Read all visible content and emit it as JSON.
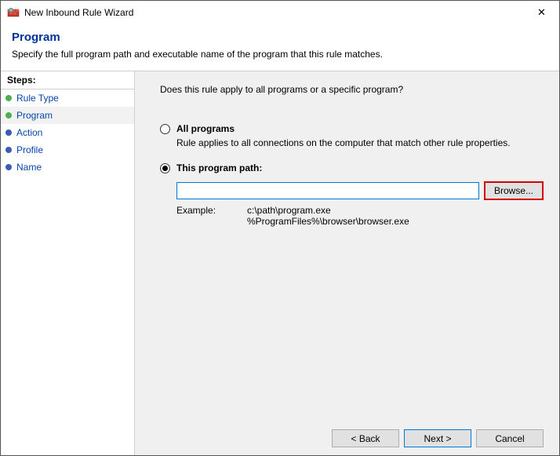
{
  "window": {
    "title": "New Inbound Rule Wizard",
    "close_glyph": "✕"
  },
  "header": {
    "title": "Program",
    "subtitle": "Specify the full program path and executable name of the program that this rule matches."
  },
  "sidebar": {
    "header": "Steps:",
    "items": [
      {
        "label": "Rule Type",
        "bullet_color": "#4caf50",
        "selected": false
      },
      {
        "label": "Program",
        "bullet_color": "#4caf50",
        "selected": true
      },
      {
        "label": "Action",
        "bullet_color": "#3b5bb5",
        "selected": false
      },
      {
        "label": "Profile",
        "bullet_color": "#3b5bb5",
        "selected": false
      },
      {
        "label": "Name",
        "bullet_color": "#3b5bb5",
        "selected": false
      }
    ]
  },
  "content": {
    "question": "Does this rule apply to all programs or a specific program?",
    "options": {
      "all": {
        "title": "All programs",
        "desc": "Rule applies to all connections on the computer that match other rule properties."
      },
      "path": {
        "title": "This program path:",
        "input_value": "",
        "browse_label": "Browse...",
        "example_label": "Example:",
        "example_text": "c:\\path\\program.exe\n%ProgramFiles%\\browser\\browser.exe"
      }
    }
  },
  "footer": {
    "back": "< Back",
    "next": "Next >",
    "cancel": "Cancel"
  }
}
